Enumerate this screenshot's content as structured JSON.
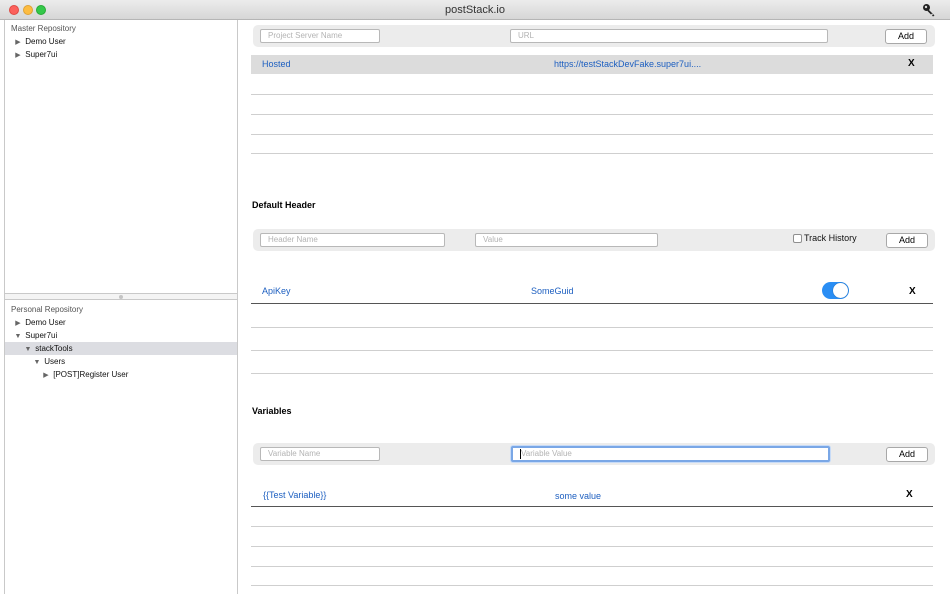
{
  "window": {
    "title": "postStack.io",
    "key_icon": "key-icon"
  },
  "sidebar": {
    "master": {
      "header": "Master Repository",
      "items": [
        {
          "label": "Demo User",
          "expanded": false
        },
        {
          "label": "Super7ui",
          "expanded": false
        }
      ]
    },
    "personal": {
      "header": "Personal Repository",
      "items": [
        {
          "label": "Demo User",
          "expanded": false
        },
        {
          "label": "Super7ui",
          "expanded": true
        },
        {
          "label": "stackTools",
          "expanded": true,
          "selected": true
        },
        {
          "label": "Users",
          "expanded": true
        },
        {
          "label": "[POST]Register User",
          "expanded": false
        }
      ]
    }
  },
  "servers": {
    "name_placeholder": "Project Server Name",
    "url_placeholder": "URL",
    "add_label": "Add",
    "rows": [
      {
        "name": "Hosted",
        "url": "https://testStackDevFake.super7ui....",
        "remove": "X"
      }
    ]
  },
  "default_header": {
    "title": "Default Header",
    "name_placeholder": "Header Name",
    "value_placeholder": "Value",
    "track_history_label": "Track History",
    "track_history_checked": false,
    "add_label": "Add",
    "rows": [
      {
        "name": "ApiKey",
        "value": "SomeGuid",
        "enabled": true,
        "remove": "X"
      }
    ]
  },
  "variables": {
    "title": "Variables",
    "name_placeholder": "Variable Name",
    "value_placeholder": "Variable Value",
    "add_label": "Add",
    "rows": [
      {
        "name": "{{Test Variable}}",
        "value": "some value",
        "remove": "X"
      }
    ]
  },
  "colors": {
    "accent": "#2a8ef4",
    "link": "#1d5fc0",
    "selection": "#dcdde2"
  }
}
